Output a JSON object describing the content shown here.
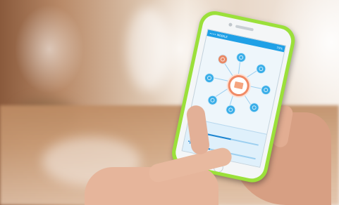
{
  "scene": {
    "description_free": true,
    "phone": {
      "case_color": "#9be03a",
      "screen_accent": "#1fa0e6",
      "highlight_color": "#f08a66",
      "status_bar": {
        "left_text": "•••• MOBILE",
        "time": "",
        "battery": "75%"
      },
      "icons": {
        "hub": "hub-device-icon",
        "thermometer": "thermometer-icon",
        "fan": "fan-icon"
      },
      "sliders": [
        {
          "name": "temperature",
          "level": 0.55
        },
        {
          "name": "fan",
          "level": 0.25
        }
      ]
    }
  }
}
